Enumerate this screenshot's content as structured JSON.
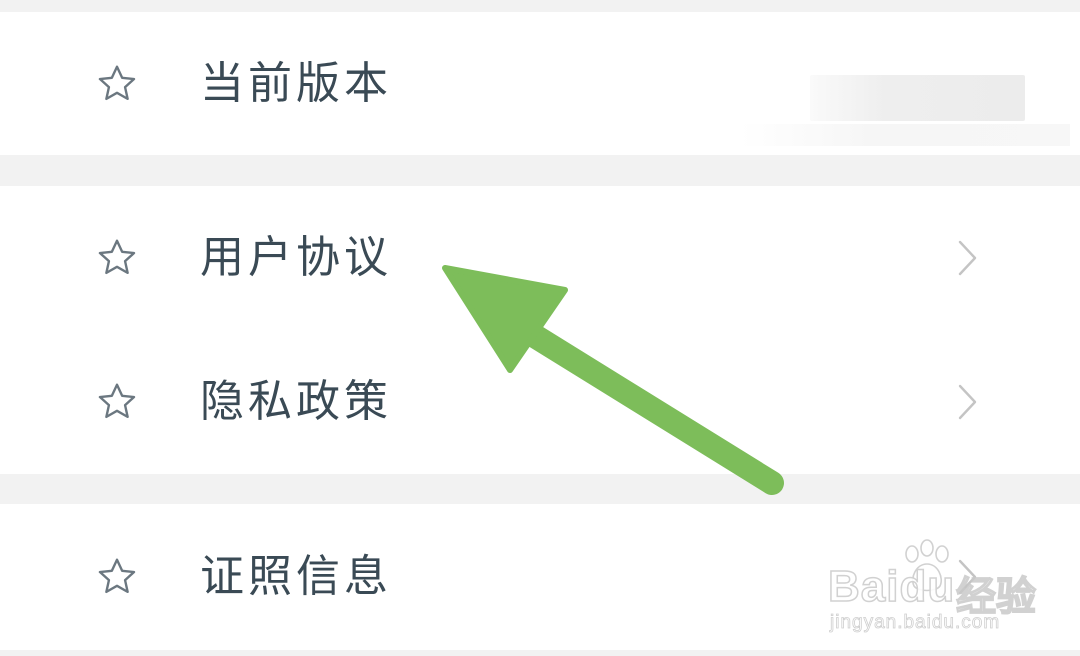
{
  "settings": {
    "items": [
      {
        "label": "当前版本",
        "icon": "star-outline-icon",
        "has_chevron": false
      },
      {
        "label": "用户协议",
        "icon": "star-outline-icon",
        "has_chevron": true
      },
      {
        "label": "隐私政策",
        "icon": "star-outline-icon",
        "has_chevron": true
      },
      {
        "label": "证照信息",
        "icon": "star-outline-icon",
        "has_chevron": true
      }
    ]
  },
  "watermark": {
    "brand": "Baidu",
    "cn": "经验",
    "url": "jingyan.baidu.com"
  },
  "colors": {
    "background": "#f2f2f2",
    "card": "#ffffff",
    "label_text": "#3a4a55",
    "icon_stroke": "#6b7780",
    "chevron": "#c4c4c4",
    "annotation_arrow": "#7dbd5a"
  }
}
